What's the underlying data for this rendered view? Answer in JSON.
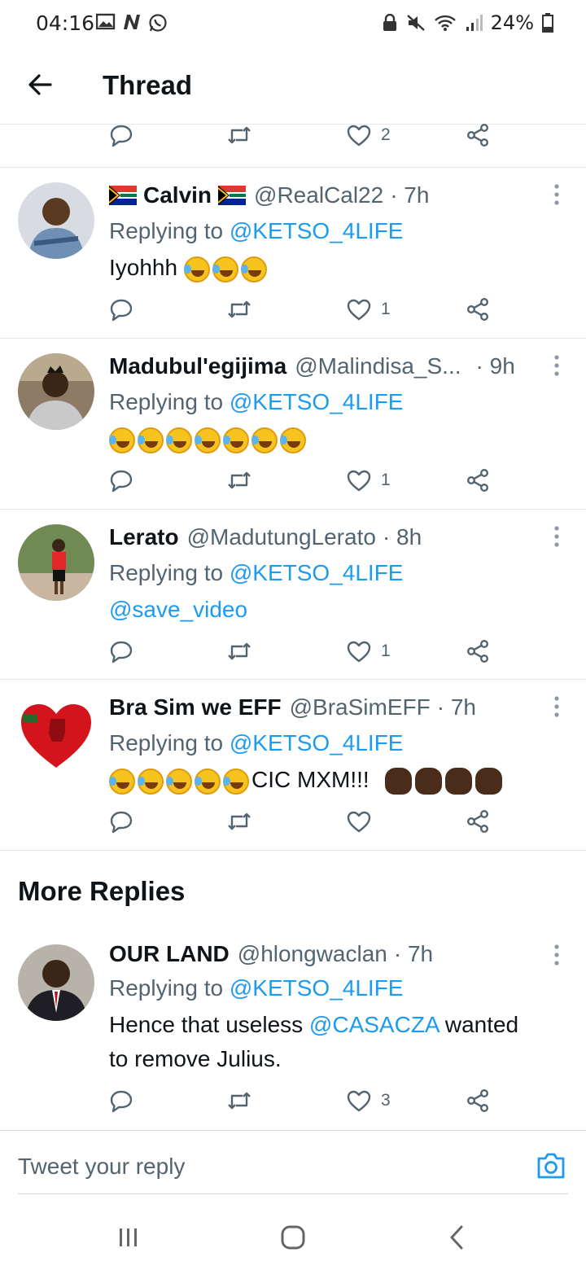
{
  "status_bar": {
    "time": "04:16",
    "battery": "24%"
  },
  "header": {
    "title": "Thread"
  },
  "top_actions": {
    "like_count": "2"
  },
  "tweets": [
    {
      "name": "Calvin",
      "handle": "@RealCal22",
      "time": "· 7h",
      "replying_prefix": "Replying to",
      "replying_to": "@KETSO_4LIFE",
      "text": "Iyohhh",
      "like_count": "1"
    },
    {
      "name": "Madubul'egijima",
      "handle": "@Malindisa_S...",
      "time": "· 9h",
      "replying_prefix": "Replying to",
      "replying_to": "@KETSO_4LIFE",
      "text": "",
      "like_count": "1"
    },
    {
      "name": "Lerato",
      "handle": "@MadutungLerato",
      "time": "· 8h",
      "replying_prefix": "Replying to",
      "replying_to": "@KETSO_4LIFE",
      "text": "@save_video",
      "like_count": "1"
    },
    {
      "name": "Bra Sim we EFF",
      "handle": "@BraSimEFF",
      "time": "· 7h",
      "replying_prefix": "Replying to",
      "replying_to": "@KETSO_4LIFE",
      "text": "CIC MXM!!!",
      "like_count": ""
    }
  ],
  "more_replies": {
    "title": "More Replies",
    "tweet": {
      "name": "OUR LAND",
      "handle": "@hlongwaclan",
      "time": "· 7h",
      "replying_prefix": "Replying to",
      "replying_to": "@KETSO_4LIFE",
      "text_before": "Hence that useless",
      "text_mention": "@CASACZA",
      "text_after": "wanted",
      "text_line2": "to remove Julius.",
      "like_count": "3"
    }
  },
  "composer": {
    "placeholder": "Tweet your reply"
  },
  "icons": {
    "reply": "reply-icon",
    "retweet": "retweet-icon",
    "like": "heart-icon",
    "share": "share-icon",
    "more": "more-icon",
    "camera": "camera-icon",
    "back": "back-arrow-icon"
  },
  "colors": {
    "accent": "#1d9bf0",
    "secondary_text": "#536471",
    "primary_text": "#0f1419"
  }
}
